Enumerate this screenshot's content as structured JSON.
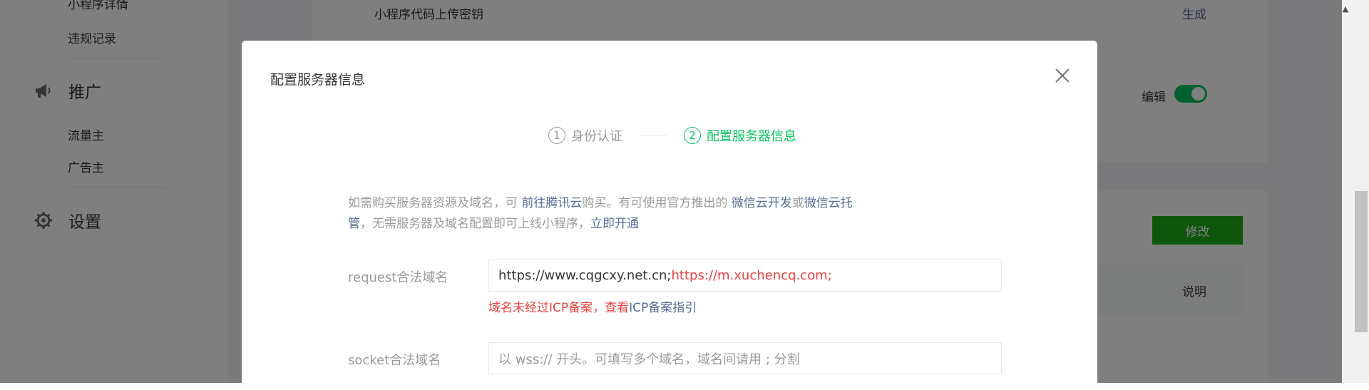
{
  "sidebar": {
    "items_top": [
      "小程序详情",
      "违规记录"
    ],
    "promote": {
      "icon": "megaphone-icon",
      "label": "推广",
      "items": [
        "流量主",
        "广告主"
      ]
    },
    "settings": {
      "icon": "gear-icon",
      "label": "设置"
    }
  },
  "main": {
    "upload_key_label": "小程序代码上传密钥",
    "generate_link": "生成",
    "edit_label": "编辑",
    "toggle_on": true,
    "modify_button": "修改",
    "explain_header": "说明"
  },
  "modal": {
    "title": "配置服务器信息",
    "steps": [
      {
        "num": "1",
        "label": "身份认证",
        "active": false
      },
      {
        "num": "2",
        "label": "配置服务器信息",
        "active": true
      }
    ],
    "notice": {
      "t1": "如需购买服务器资源及域名，可 ",
      "link_tencent": "前往腾讯云",
      "t2": "购买。有可使用官方推出的 ",
      "link_cloud_dev": "微信云开发",
      "t3": "或",
      "link_cloud_host": "微信云托管",
      "t4": "，无需服务器及域名配置即可上线小程序，",
      "link_open": "立即开通"
    },
    "request_domain": {
      "label": "request合法域名",
      "value_ok": "https://www.cqgcxy.net.cn;",
      "value_bad": "https://m.xuchencq.com;",
      "error_text": "域名未经过ICP备案，查看",
      "error_link": "ICP备案指引"
    },
    "socket_domain": {
      "label": "socket合法域名",
      "placeholder": "以 wss:// 开头。可填写多个域名，域名间请用 ; 分割"
    }
  },
  "colors": {
    "accent": "#07c160",
    "link": "#576b95",
    "error": "#e64340",
    "muted": "#9a9a9a"
  }
}
